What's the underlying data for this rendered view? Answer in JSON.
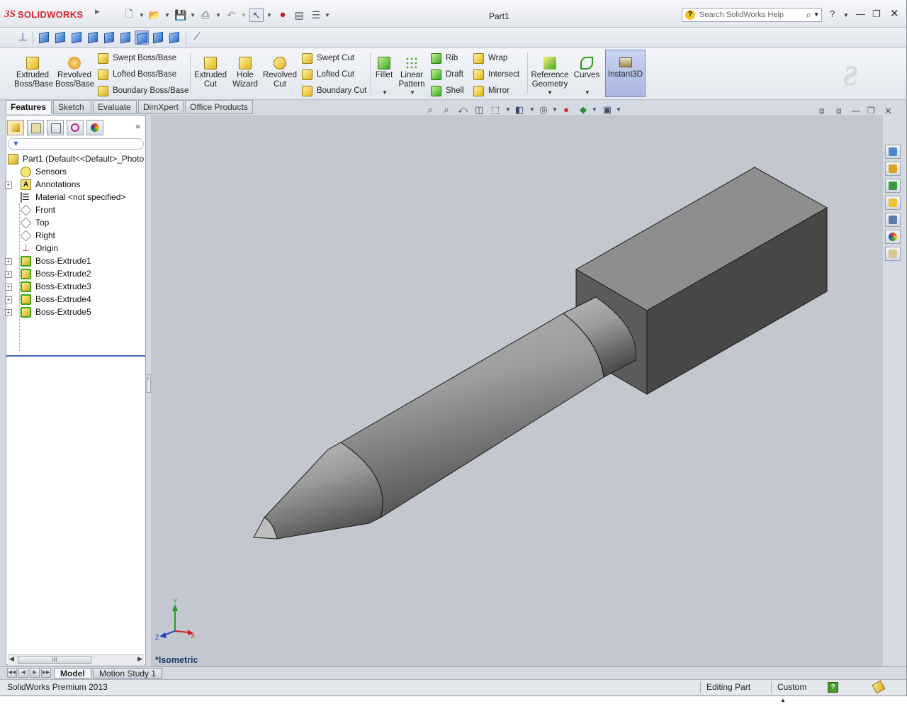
{
  "app": {
    "logo_prefix": "3S",
    "logo_name": "SOLIDWORKS",
    "document_title": "Part1",
    "help_search_placeholder": "Search SolidWorks Help"
  },
  "command_manager": {
    "extruded_boss": "Extruded Boss/Base",
    "revolved_boss": "Revolved Boss/Base",
    "swept_boss": "Swept Boss/Base",
    "lofted_boss": "Lofted Boss/Base",
    "boundary_boss": "Boundary Boss/Base",
    "extruded_cut": "Extruded Cut",
    "hole_wizard": "Hole Wizard",
    "revolved_cut": "Revolved Cut",
    "swept_cut": "Swept Cut",
    "lofted_cut": "Lofted Cut",
    "boundary_cut": "Boundary Cut",
    "fillet": "Fillet",
    "linear_pattern": "Linear Pattern",
    "rib": "Rib",
    "draft": "Draft",
    "shell": "Shell",
    "wrap": "Wrap",
    "intersect": "Intersect",
    "mirror": "Mirror",
    "reference_geometry": "Reference Geometry",
    "curves": "Curves",
    "instant3d": "Instant3D"
  },
  "tabs": [
    "Features",
    "Sketch",
    "Evaluate",
    "DimXpert",
    "Office Products"
  ],
  "tree": {
    "root": "Part1  (Default<<Default>_Photo",
    "items": [
      {
        "label": "Sensors",
        "icon": "sensors-icon",
        "expandable": false
      },
      {
        "label": "Annotations",
        "icon": "annotations-icon",
        "expandable": true
      },
      {
        "label": "Material <not specified>",
        "icon": "material-icon",
        "expandable": false
      },
      {
        "label": "Front",
        "icon": "plane-icon",
        "expandable": false
      },
      {
        "label": "Top",
        "icon": "plane-icon",
        "expandable": false
      },
      {
        "label": "Right",
        "icon": "plane-icon",
        "expandable": false
      },
      {
        "label": "Origin",
        "icon": "origin-icon",
        "expandable": false
      },
      {
        "label": "Boss-Extrude1",
        "icon": "extrude-icon",
        "expandable": true
      },
      {
        "label": "Boss-Extrude2",
        "icon": "extrude-icon",
        "expandable": true
      },
      {
        "label": "Boss-Extrude3",
        "icon": "extrude-icon",
        "expandable": true
      },
      {
        "label": "Boss-Extrude4",
        "icon": "extrude-icon",
        "expandable": true
      },
      {
        "label": "Boss-Extrude5",
        "icon": "extrude-icon",
        "expandable": true
      }
    ],
    "scroll_glyph": "III"
  },
  "graphics": {
    "view_name": "*Isometric",
    "triad": {
      "x": "X",
      "y": "Y",
      "z": "Z"
    }
  },
  "bottom_tabs": [
    "Model",
    "Motion Study 1"
  ],
  "status": {
    "product": "SolidWorks Premium 2013",
    "mode": "Editing Part",
    "units": "Custom"
  },
  "colors": {
    "brand": "#d8262e",
    "viewport": "#c3c7d0",
    "active_tool": "#aab6e0"
  }
}
